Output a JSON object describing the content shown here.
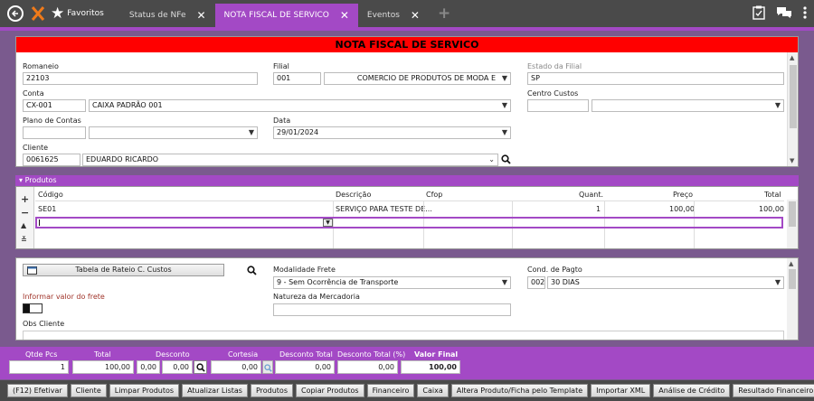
{
  "topbar": {
    "favorites_label": "Favoritos",
    "tabs": [
      {
        "label": "Status de NFe",
        "active": false
      },
      {
        "label": "NOTA FISCAL DE SERVICO",
        "active": true
      },
      {
        "label": "Eventos",
        "active": false
      }
    ]
  },
  "form": {
    "title": "NOTA FISCAL DE SERVICO",
    "romaneio_label": "Romaneio",
    "romaneio_value": "22103",
    "filial_label": "Filial",
    "filial_code": "001",
    "filial_name": "COMERCIO DE PRODUTOS DE MODA E",
    "estado_label": "Estado da Filial",
    "estado_value": "SP",
    "conta_label": "Conta",
    "conta_code": "CX-001",
    "conta_name": "CAIXA PADRÃO 001",
    "centro_label": "Centro Custos",
    "plano_label": "Plano de Contas",
    "data_label": "Data",
    "data_value": "29/01/2024",
    "cliente_label": "Cliente",
    "cliente_code": "0061625",
    "cliente_name": "EDUARDO RICARDO"
  },
  "produtos": {
    "header": "Produtos",
    "columns": {
      "codigo": "Código",
      "descricao": "Descrição",
      "cfop": "Cfop",
      "quant": "Quant.",
      "preco": "Preço",
      "total": "Total"
    },
    "rows": [
      {
        "codigo": "SE01",
        "descricao": "SERVIÇO PARA TESTE DE...",
        "cfop": "",
        "quant": "1",
        "preco": "100,00",
        "total": "100,00"
      }
    ]
  },
  "bottom": {
    "rateio_button": "Tabela de Rateio C. Custos",
    "frete_label": "Informar valor do frete",
    "obs_label": "Obs Cliente",
    "modalidade_label": "Modalidade Frete",
    "modalidade_value": "9 - Sem Ocorrência de Transporte",
    "natureza_label": "Natureza da Mercadoria",
    "cond_label": "Cond. de Pagto",
    "cond_code": "002",
    "cond_name": "30 DIAS"
  },
  "totals": {
    "qtde_label": "Qtde Pcs",
    "qtde_value": "1",
    "total_label": "Total",
    "total_value": "100,00",
    "desconto_label": "Desconto",
    "desconto_pct": "0,00",
    "desconto_value": "0,00",
    "cortesia_label": "Cortesia",
    "cortesia_value": "0,00",
    "desc_total_label": "Desconto Total",
    "desc_total_value": "0,00",
    "desc_total_pct_label": "Desconto Total (%)",
    "desc_total_pct_value": "0,00",
    "valor_final_label": "Valor Final",
    "valor_final_value": "100,00"
  },
  "actions": [
    "(F12) Efetivar",
    "Cliente",
    "Limpar Produtos",
    "Atualizar Listas",
    "Produtos",
    "Copiar Produtos",
    "Financeiro",
    "Caixa",
    "Altera Produto/Ficha pelo Template",
    "Importar XML",
    "Análise de Crédito",
    "Resultado Financeiro"
  ]
}
